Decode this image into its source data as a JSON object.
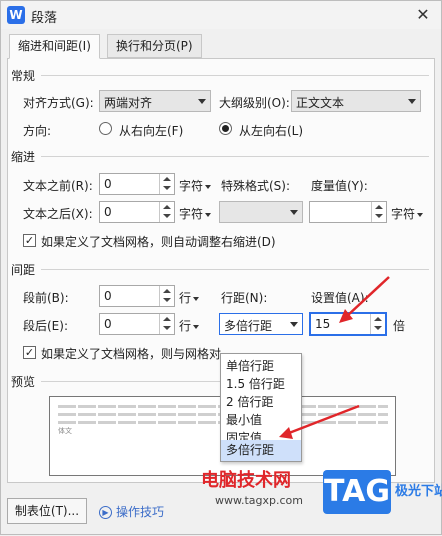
{
  "window": {
    "app_logo": "W",
    "title": "段落",
    "close_glyph": "✕"
  },
  "tabs": [
    {
      "label": "缩进和间距(I)",
      "active": true
    },
    {
      "label": "换行和分页(P)",
      "active": false
    }
  ],
  "general": {
    "section": "常规",
    "align_label": "对齐方式(G):",
    "align_value": "两端对齐",
    "outline_label": "大纲级别(O):",
    "outline_value": "正文文本",
    "direction_label": "方向:",
    "rtl_label": "从右向左(F)",
    "ltr_label": "从左向右(L)"
  },
  "indent": {
    "section": "缩进",
    "before_label": "文本之前(R):",
    "before_value": "0",
    "before_unit": "字符",
    "after_label": "文本之后(X):",
    "after_value": "0",
    "after_unit": "字符",
    "special_label": "特殊格式(S):",
    "special_value": "",
    "measure_label": "度量值(Y):",
    "measure_value": "",
    "measure_unit": "字符",
    "grid_checkbox": "如果定义了文档网格，则自动调整右缩进(D)",
    "grid_checked": true
  },
  "spacing": {
    "section": "间距",
    "before_label": "段前(B):",
    "before_value": "0",
    "before_unit": "行",
    "after_label": "段后(E):",
    "after_value": "0",
    "after_unit": "行",
    "linespacing_label": "行距(N):",
    "linespacing_value": "多倍行距",
    "setvalue_label": "设置值(A):",
    "setvalue_value": "15",
    "setvalue_unit": "倍",
    "grid_checkbox": "如果定义了文档网格，则与网格对",
    "grid_checked": true
  },
  "preview": {
    "section": "预览",
    "sample_tail": "体文"
  },
  "linespacing_options": [
    "单倍行距",
    "1.5 倍行距",
    "2 倍行距",
    "最小值",
    "固定值",
    "多倍行距"
  ],
  "footer": {
    "tabs_button": "制表位(T)...",
    "tips_label": "操作技巧"
  },
  "watermark": {
    "site_name": "电脑技术网",
    "url": "www.tagxp.com",
    "logo": "TAG",
    "side_text": "极光下站"
  },
  "colors": {
    "accent": "#2b6fe8",
    "arrow": "#e0262a",
    "highlight": "#cfe0fa"
  }
}
